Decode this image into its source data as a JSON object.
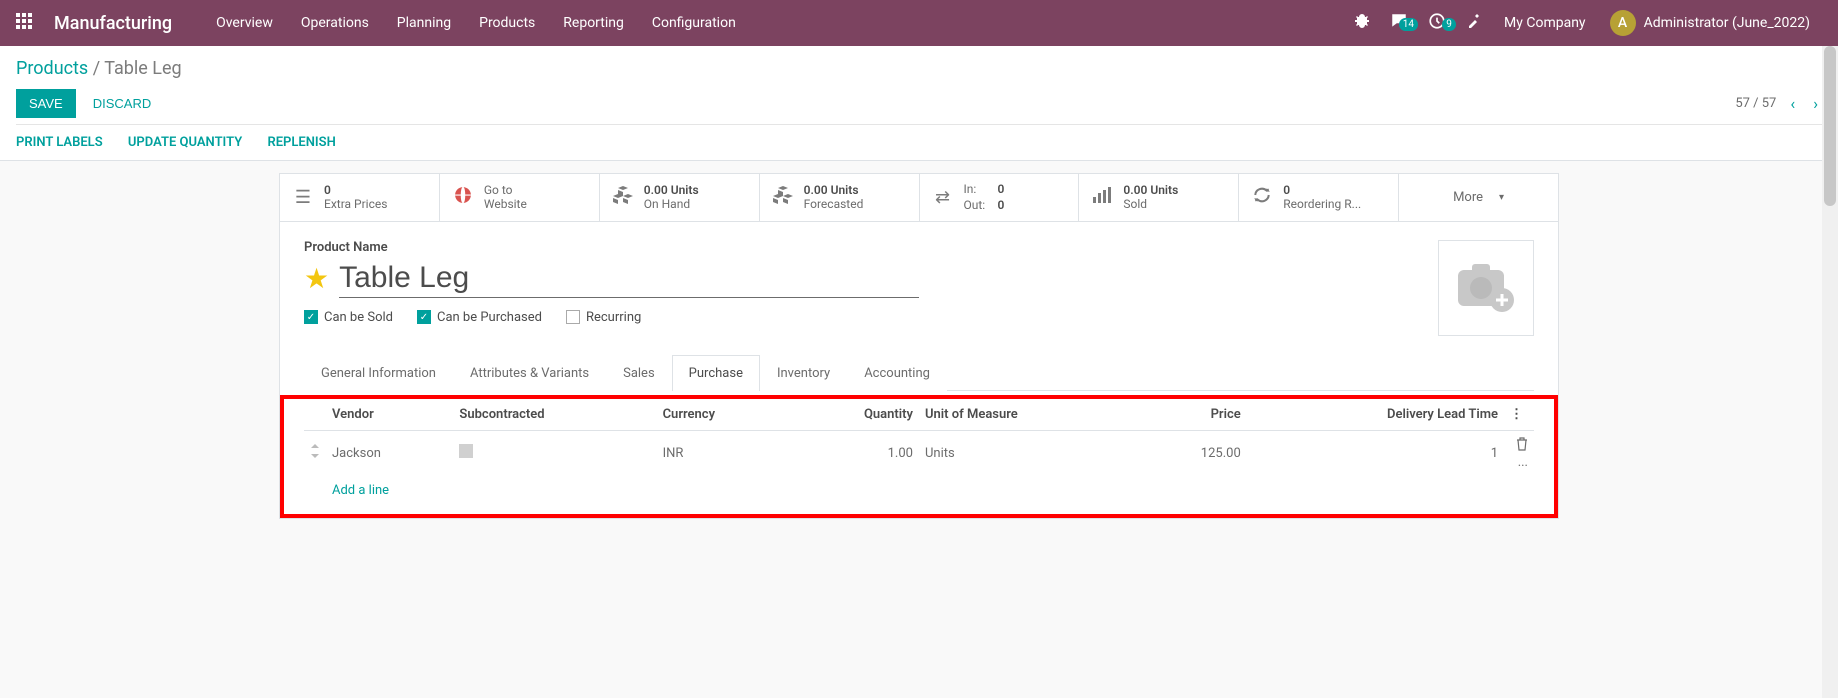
{
  "topnav": {
    "app_title": "Manufacturing",
    "items": [
      "Overview",
      "Operations",
      "Planning",
      "Products",
      "Reporting",
      "Configuration"
    ],
    "msg_badge": "14",
    "activity_badge": "9",
    "company": "My Company",
    "avatar_letter": "A",
    "user": "Administrator (June_2022)"
  },
  "breadcrumb": {
    "root": "Products",
    "current": "Table Leg"
  },
  "buttons": {
    "save": "SAVE",
    "discard": "DISCARD"
  },
  "pager": {
    "text": "57 / 57"
  },
  "actions": {
    "print_labels": "PRINT LABELS",
    "update_qty": "UPDATE QUANTITY",
    "replenish": "REPLENISH"
  },
  "stats": {
    "extra_prices": {
      "value": "0",
      "label": "Extra Prices"
    },
    "website": {
      "top": "Go to",
      "bottom": "Website"
    },
    "on_hand": {
      "value": "0.00 Units",
      "label": "On Hand"
    },
    "forecasted": {
      "value": "0.00 Units",
      "label": "Forecasted"
    },
    "in": {
      "label": "In:",
      "value": "0"
    },
    "out": {
      "label": "Out:",
      "value": "0"
    },
    "sold": {
      "value": "0.00 Units",
      "label": "Sold"
    },
    "reorder": {
      "value": "0",
      "label": "Reordering R..."
    },
    "more": "More"
  },
  "form": {
    "product_name_label": "Product Name",
    "product_name": "Table Leg",
    "can_be_sold": "Can be Sold",
    "can_be_purchased": "Can be Purchased",
    "recurring": "Recurring"
  },
  "tabs": [
    "General Information",
    "Attributes & Variants",
    "Sales",
    "Purchase",
    "Inventory",
    "Accounting"
  ],
  "table": {
    "headers": {
      "vendor": "Vendor",
      "subcontracted": "Subcontracted",
      "currency": "Currency",
      "quantity": "Quantity",
      "uom": "Unit of Measure",
      "price": "Price",
      "lead": "Delivery Lead Time"
    },
    "rows": [
      {
        "vendor": "Jackson",
        "currency": "INR",
        "quantity": "1.00",
        "uom": "Units",
        "price": "125.00",
        "lead": "1"
      }
    ],
    "add_line": "Add a line"
  }
}
